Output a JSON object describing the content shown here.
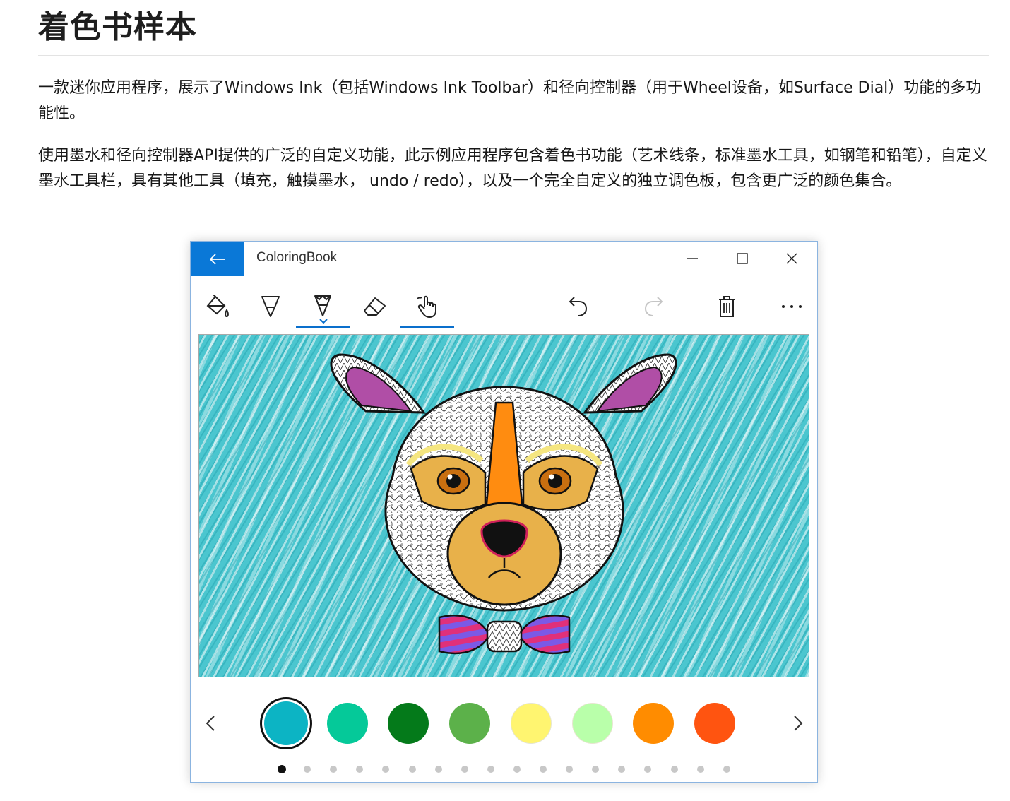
{
  "doc": {
    "title": "着色书样本",
    "para1": "一款迷你应用程序，展示了Windows Ink（包括Windows Ink Toolbar）和径向控制器（用于Wheel设备，如Surface Dial）功能的多功能性。",
    "para2": "使用墨水和径向控制器API提供的广泛的自定义功能，此示例应用程序包含着色书功能（艺术线条，标准墨水工具，如钢笔和铅笔），自定义墨水工具栏，具有其他工具（填充，触摸墨水， undo / redo），以及一个完全自定义的独立调色板，包含更广泛的颜色集合。"
  },
  "app": {
    "title": "ColoringBook",
    "back_icon": "arrow-left-icon",
    "caption_icons": [
      "minimize-icon",
      "maximize-icon",
      "close-icon"
    ],
    "accent": "#0a78d7"
  },
  "toolbar": {
    "left_tools": [
      {
        "icon": "paint-bucket-icon",
        "selected": false
      },
      {
        "icon": "pen-icon",
        "selected": false
      },
      {
        "icon": "pencil-icon",
        "selected": true
      },
      {
        "icon": "eraser-icon",
        "selected": false
      },
      {
        "icon": "touch-writing-icon",
        "selected": true
      }
    ],
    "right_tools": [
      {
        "icon": "undo-icon",
        "enabled": true
      },
      {
        "icon": "redo-icon",
        "enabled": false
      },
      {
        "icon": "delete-icon",
        "enabled": true
      },
      {
        "icon": "more-icon",
        "enabled": true
      }
    ]
  },
  "canvas": {
    "background_color": "#4bc6cf",
    "artwork": "dog-mandala-line-art"
  },
  "palette": {
    "colors": [
      "#0cb4c4",
      "#05c999",
      "#047a1a",
      "#5cb14a",
      "#fff570",
      "#b9ffaa",
      "#ff8c00",
      "#ff5410"
    ],
    "selected_index": 0,
    "page_count": 18,
    "current_page": 0
  }
}
